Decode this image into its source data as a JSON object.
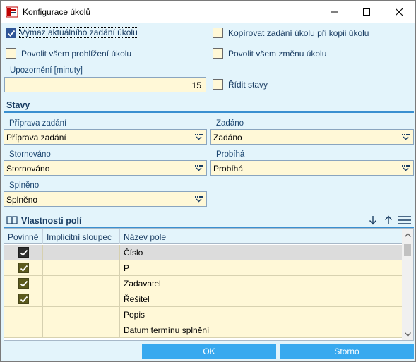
{
  "window": {
    "title": "Konfigurace úkolů"
  },
  "options": {
    "vymaz_label": "Výmaz aktuálního zadání úkolu",
    "vymaz_checked": true,
    "kopirovat_label": "Kopírovat zadání úkolu při kopii úkolu",
    "kopirovat_checked": false,
    "prohlizeni_label": "Povolit všem prohlížení úkolu",
    "prohlizeni_checked": false,
    "zmena_label": "Povolit všem změnu úkolu",
    "zmena_checked": false,
    "ridit_label": "Řídit stavy",
    "ridit_checked": false
  },
  "upozorneni": {
    "label": "Upozornění [minuty]",
    "value": "15"
  },
  "stavy": {
    "title": "Stavy",
    "priprava": {
      "label": "Příprava zadání",
      "value": "Příprava zadání"
    },
    "zadano": {
      "label": "Zadáno",
      "value": "Zadáno"
    },
    "stornovano": {
      "label": "Stornováno",
      "value": "Stornováno"
    },
    "probiha": {
      "label": "Probíhá",
      "value": "Probíhá"
    },
    "splneno": {
      "label": "Splněno",
      "value": "Splněno"
    }
  },
  "vlastnosti": {
    "title": "Vlastnosti polí",
    "columns": [
      "Povinné",
      "Implicitní sloupec",
      "Název pole"
    ],
    "rows": [
      {
        "povinne": true,
        "implicitni": "",
        "nazev": "Číslo"
      },
      {
        "povinne": true,
        "implicitni": "",
        "nazev": "P"
      },
      {
        "povinne": true,
        "implicitni": "",
        "nazev": "Zadavatel"
      },
      {
        "povinne": true,
        "implicitni": "",
        "nazev": "Řešitel"
      },
      {
        "povinne": false,
        "implicitni": "",
        "nazev": "Popis"
      },
      {
        "povinne": false,
        "implicitni": "",
        "nazev": "Datum termínu splnění"
      }
    ]
  },
  "buttons": {
    "ok": "OK",
    "storno": "Storno"
  },
  "colors": {
    "accent": "#38a9ef",
    "background": "#e3f4fb",
    "input": "#fff8d7",
    "checked": "#2f5597"
  }
}
